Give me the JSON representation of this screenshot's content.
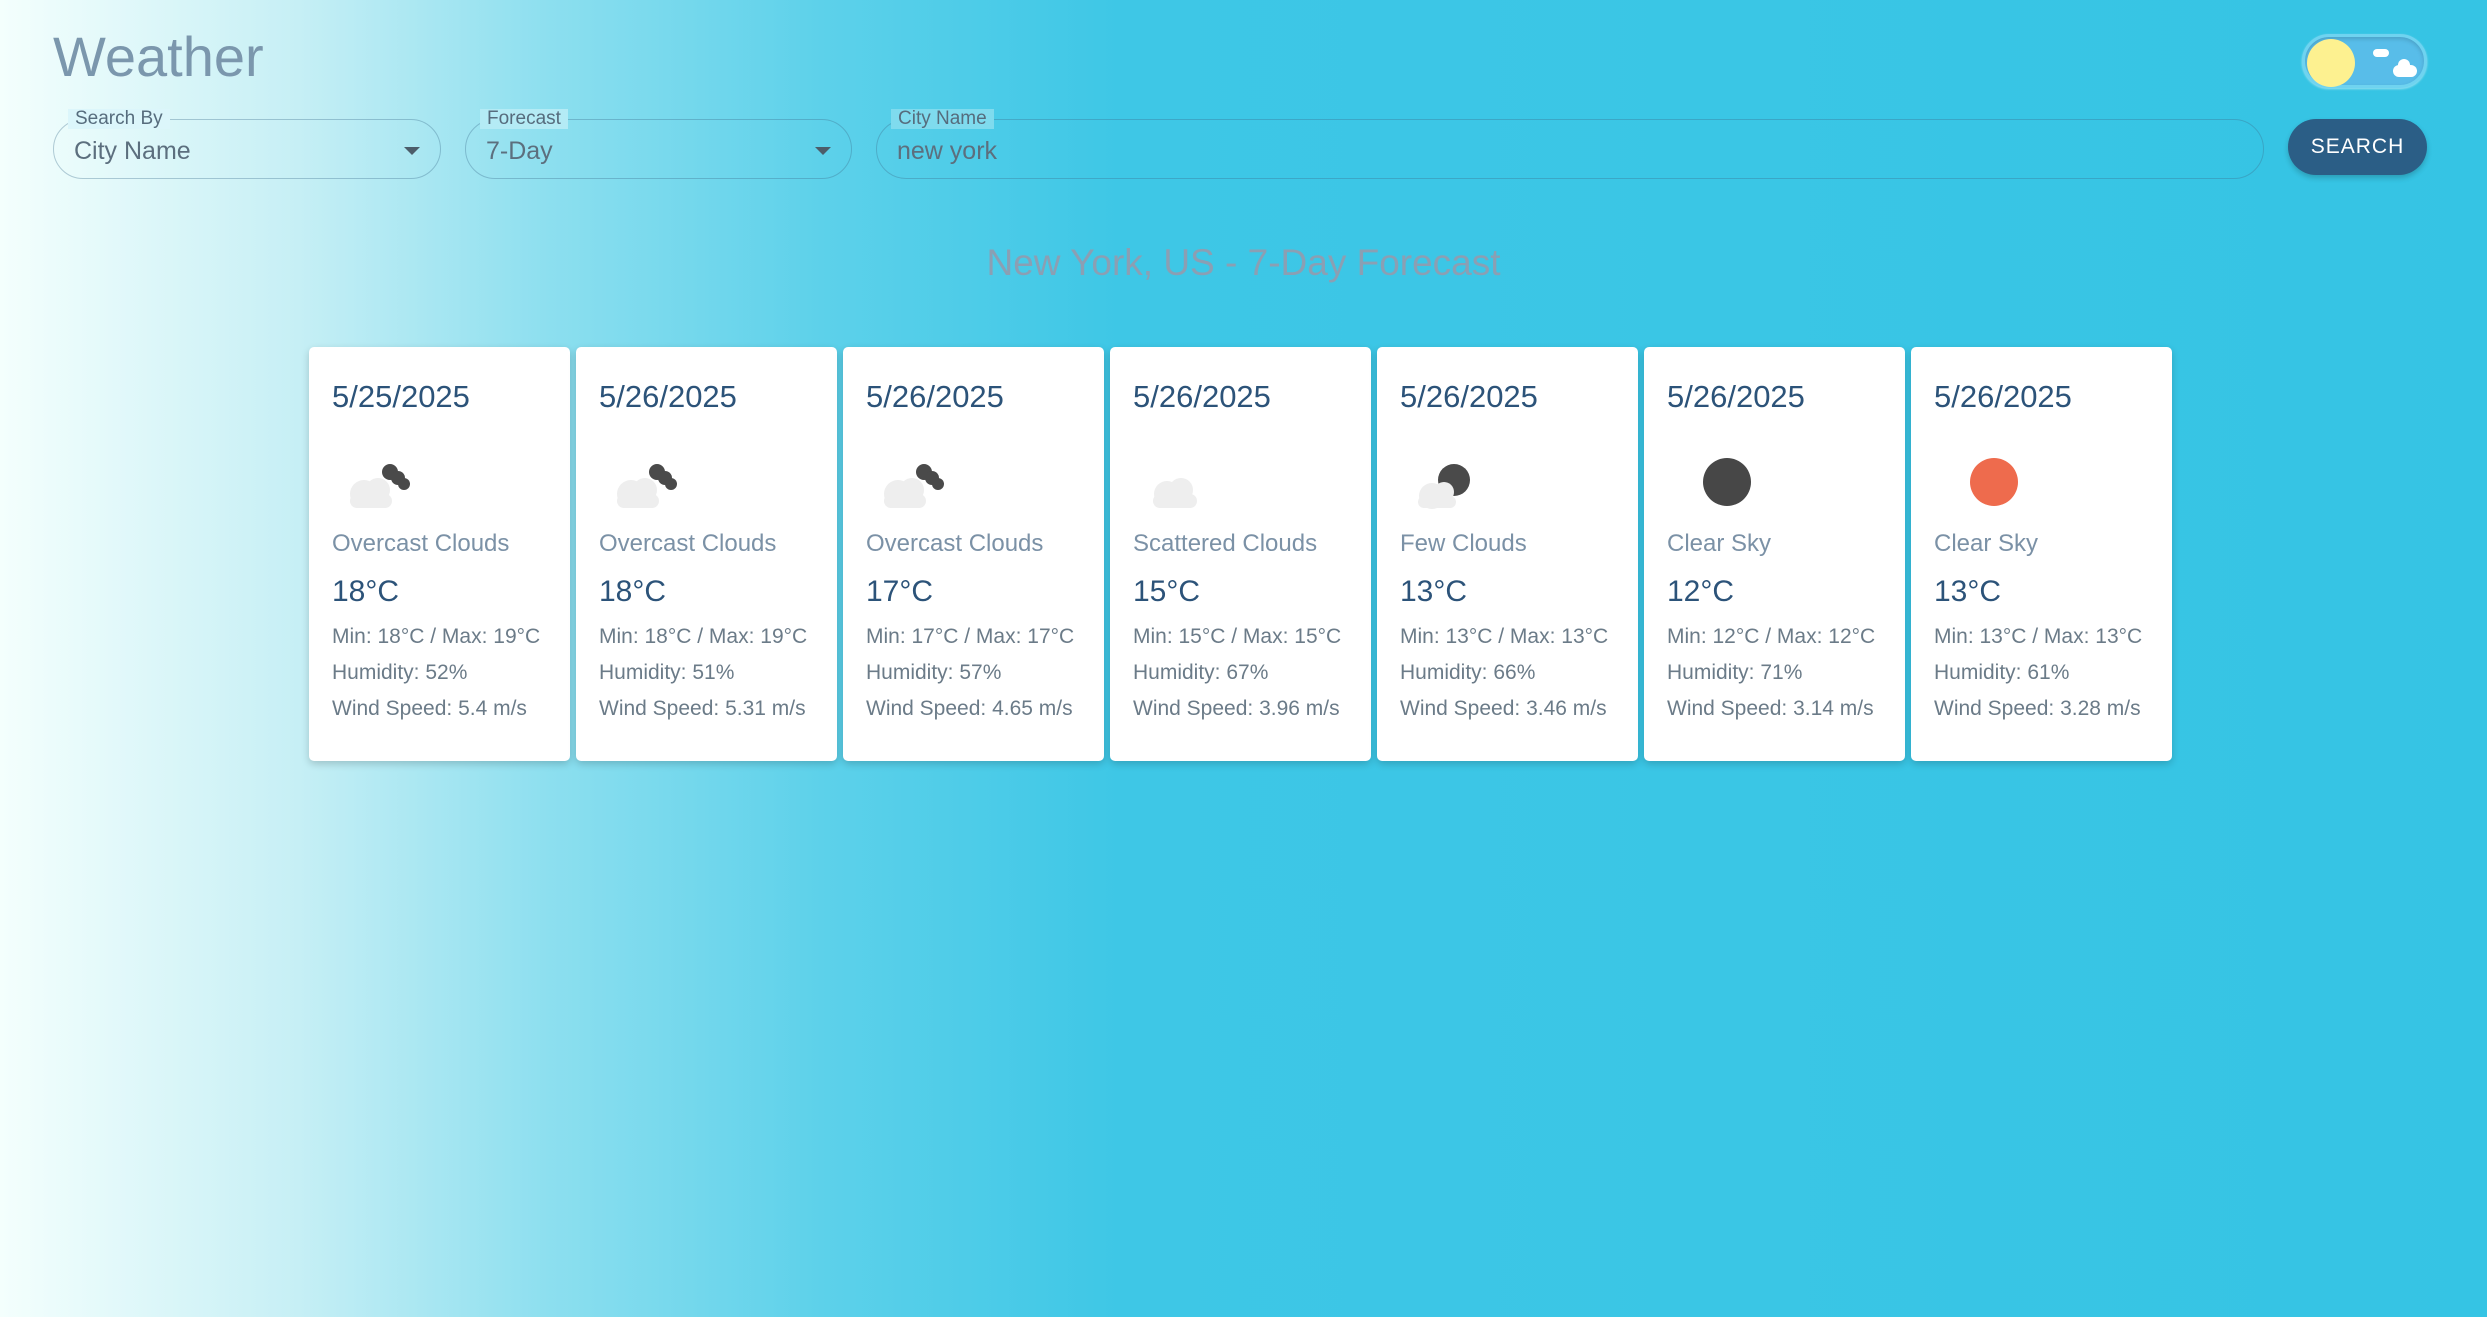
{
  "app": {
    "title": "Weather"
  },
  "controls": {
    "search_by": {
      "label": "Search By",
      "value": "City Name"
    },
    "forecast": {
      "label": "Forecast",
      "value": "7-Day"
    },
    "city": {
      "label": "City Name",
      "value": "new york"
    },
    "search_button": "SEARCH"
  },
  "theme_toggle": {
    "state": "light"
  },
  "forecast_title": "New York, US - 7-Day Forecast",
  "days": [
    {
      "date": "5/25/2025",
      "icon": "overcast-clouds-icon",
      "desc": "Overcast Clouds",
      "temp": "18°C",
      "minmax": "Min: 18°C / Max: 19°C",
      "humidity": "Humidity: 52%",
      "wind": "Wind Speed: 5.4 m/s"
    },
    {
      "date": "5/26/2025",
      "icon": "overcast-clouds-icon",
      "desc": "Overcast Clouds",
      "temp": "18°C",
      "minmax": "Min: 18°C / Max: 19°C",
      "humidity": "Humidity: 51%",
      "wind": "Wind Speed: 5.31 m/s"
    },
    {
      "date": "5/26/2025",
      "icon": "overcast-clouds-icon",
      "desc": "Overcast Clouds",
      "temp": "17°C",
      "minmax": "Min: 17°C / Max: 17°C",
      "humidity": "Humidity: 57%",
      "wind": "Wind Speed: 4.65 m/s"
    },
    {
      "date": "5/26/2025",
      "icon": "scattered-clouds-icon",
      "desc": "Scattered Clouds",
      "temp": "15°C",
      "minmax": "Min: 15°C / Max: 15°C",
      "humidity": "Humidity: 67%",
      "wind": "Wind Speed: 3.96 m/s"
    },
    {
      "date": "5/26/2025",
      "icon": "few-clouds-night-icon",
      "desc": "Few Clouds",
      "temp": "13°C",
      "minmax": "Min: 13°C / Max: 13°C",
      "humidity": "Humidity: 66%",
      "wind": "Wind Speed: 3.46 m/s"
    },
    {
      "date": "5/26/2025",
      "icon": "clear-sky-night-icon",
      "desc": "Clear Sky",
      "temp": "12°C",
      "minmax": "Min: 12°C / Max: 12°C",
      "humidity": "Humidity: 71%",
      "wind": "Wind Speed: 3.14 m/s"
    },
    {
      "date": "5/26/2025",
      "icon": "clear-sky-day-icon",
      "desc": "Clear Sky",
      "temp": "13°C",
      "minmax": "Min: 13°C / Max: 13°C",
      "humidity": "Humidity: 61%",
      "wind": "Wind Speed: 3.28 m/s"
    }
  ],
  "colors": {
    "accent": "#2b5e86",
    "sun": "#ee6b4d",
    "moon": "#474747",
    "cloud": "#eeeeee"
  }
}
